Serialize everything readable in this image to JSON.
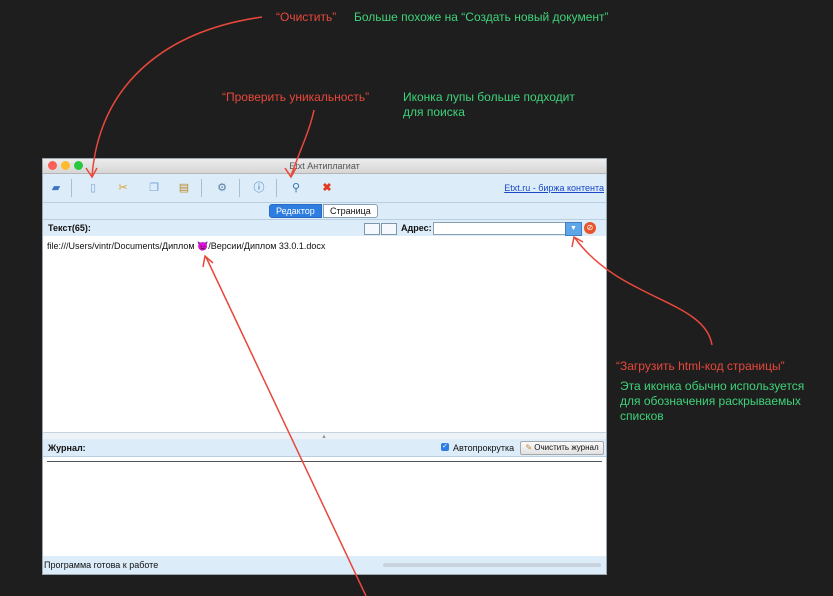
{
  "annotations": {
    "clear_label": "“Очистить”",
    "clear_comment": "Больше похоже на “Создать новый документ”",
    "check_label": "“Проверить уникальность”",
    "check_comment_line1": "Иконка лупы больше подходит",
    "check_comment_line2": "для поиска",
    "load_label": "“Загрузить html-код страницы”",
    "load_comment_line1": "Эта иконка обычно используется",
    "load_comment_line2": "для обозначения раскрываемых",
    "load_comment_line3": "списков",
    "red_color": "#e8483c",
    "green_color": "#3fd37a"
  },
  "window": {
    "title": "Etxt Антиплагиат",
    "toolbar": {
      "icons": [
        "folder-icon",
        "new-document-icon",
        "cut-icon",
        "copy-icon",
        "paste-icon",
        "settings-icon",
        "info-icon",
        "magnifier-icon",
        "close-x-icon"
      ],
      "link": "Etxt.ru - биржа контента"
    },
    "tabs": {
      "editor": "Редактор",
      "page": "Страница"
    },
    "text_panel": {
      "label": "Текст(65):",
      "address_label": "Адрес:",
      "address_value": "",
      "content": "file:///Users/vintr/Documents/Диплом 😈/Версии/Диплом 33.0.1.docx"
    },
    "log_panel": {
      "label": "Журнал:",
      "autoscroll_label": "Автопрокрутка",
      "autoscroll_checked": true,
      "clear_button": "Очистить журнал"
    },
    "status": "Программа готова к работе"
  }
}
